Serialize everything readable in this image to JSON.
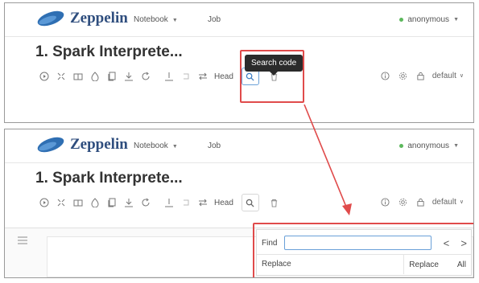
{
  "app": {
    "brand": "Zeppelin",
    "nav": [
      {
        "label": "Notebook",
        "has_dropdown": true
      },
      {
        "label": "Job",
        "has_dropdown": false
      }
    ],
    "user": "anonymous",
    "user_status_color": "#5cb85c",
    "brand_color": "#2f4e7e"
  },
  "note": {
    "title": "1. Spark Interprete..."
  },
  "toolbar": {
    "run_all_icon": "play-circle-icon",
    "show_hide_code_icon": "expand-icon",
    "show_hide_output_icon": "book-icon",
    "clear_output_icon": "eraser-icon",
    "clone_icon": "copy-icon",
    "export_icon": "download-icon",
    "reload_icon": "refresh-icon",
    "head_label": "Head",
    "search_tooltip": "Search code",
    "default_label": "default"
  },
  "find_panel": {
    "find_label": "Find",
    "find_value": "",
    "prev_glyph": "<",
    "next_glyph": ">",
    "replace_label": "Replace",
    "replace_button": "Replace",
    "all_button": "All"
  },
  "colors": {
    "highlight": "#e04b4b",
    "search_active": "#3f7fc4"
  }
}
